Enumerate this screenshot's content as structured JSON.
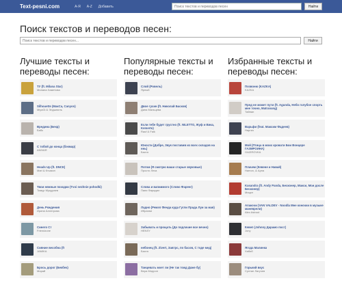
{
  "header": {
    "brand": "Text-pesni.com",
    "nav": [
      "A-Я",
      "A-Z",
      "Добавить"
    ],
    "search_placeholder": "Поиск текстов и переводов песен",
    "search_button": "Найти"
  },
  "main": {
    "title": "Поиск текстов и переводов песен:",
    "search_placeholder": "Поиск текстов и переводов песен...",
    "search_button": "Найти"
  },
  "columns": [
    {
      "title": "Лучшие тексты и переводы песен:",
      "items": [
        {
          "song": "ТУ (ft. Milana Star)",
          "artist": "Милана Хаметова",
          "thumb": "#c9a23c"
        },
        {
          "song": "Silhouette (МакСа, Canyon)",
          "artist": "MiyaGi & Эндшпиль",
          "thumb": "#5d6e86"
        },
        {
          "song": "Вредина (Бекр)",
          "artist": "Бабк",
          "thumb": "#b9b3ad"
        },
        {
          "song": "С тобой до конца (бэкмар)",
          "artist": "ANIVAR",
          "thumb": "#3a3d45"
        },
        {
          "song": "Heads Up (ft. DNCE)",
          "artist": "Mari & Ктымон",
          "thumb": "#8a7560"
        },
        {
          "song": "Твои нежные походки (Tvoi nezhnie pohodki)",
          "artist": "Тимур Муцураев",
          "thumb": "#6b5d52"
        },
        {
          "song": "День Рождения",
          "artist": "Ирина Аллегрова",
          "thumb": "#b05a3a"
        },
        {
          "song": "Синего Ст",
          "artist": "Friendzone",
          "thumb": "#7d98a4"
        },
        {
          "song": "Сияние весобна (ft",
          "artist": "JAMIKA",
          "thumb": "#2f3b4a"
        },
        {
          "song": "Брось дорог (Бекбек)",
          "artist": "Мирай",
          "thumb": "#a49c7c"
        }
      ]
    },
    {
      "title": "Популярные тексты и переводы песен:",
      "items": [
        {
          "song": "Слой (Ровель)",
          "artist": "Ярный",
          "thumb": "#3d4250"
        },
        {
          "song": "Двое гусин (ft. Николай Басков)",
          "artist": "Дина Мальцева",
          "thumb": "#8e7f73"
        },
        {
          "song": "Если тебе будет грустно (ft. NILETTO, Жуф и Вика, Kemerto)",
          "artist": "Rauf & Faik",
          "thumb": "#4a4a4a"
        },
        {
          "song": "Юности (Добре, Звук поставив из всех складов на ннь)",
          "artist": "Баста",
          "thumb": "#5e5a56"
        },
        {
          "song": "Потом (Я смотрю ваши старые звуковые)",
          "artist": "Просто Леха",
          "thumb": "#c9c3bc"
        },
        {
          "song": "Слова и вапиимого (Слово Фаренг)",
          "artist": "Пани Фарадил",
          "thumb": "#343a44"
        },
        {
          "song": "Ладно (Ремэп Фенда куда Гугли Прада Луи за мая)",
          "artist": "Ибрагим",
          "thumb": "#6f665d"
        },
        {
          "song": "Забывать и прощать (До подлачие все вечно)",
          "artist": "HENSY",
          "thumb": "#d7d2cc"
        },
        {
          "song": "небонец (ft. Zivert, Завтрс, по басов, С тоде мед)",
          "artist": "Баста",
          "thumb": "#7a6a58"
        },
        {
          "song": "Танцевать моет ли (Не так тожд Даже бу)",
          "artist": "Вера Моррон",
          "thumb": "#8c6ea2"
        }
      ]
    },
    {
      "title": "Избранные тексты и переводы песен:",
      "items": [
        {
          "song": "Позвоню (KAZKA)",
          "artist": "KAZKA",
          "thumb": "#b8453b"
        },
        {
          "song": "Пред не может пути (ft. Agunda, Небо голубое спорть мне точно, Matranang)",
          "artist": "Тайпан",
          "thumb": "#d1ccc6"
        },
        {
          "song": "Варьфи (feat. Максим Фадеев)",
          "artist": "Наргиз",
          "thumb": "#3f4351"
        },
        {
          "song": "Мой (Птица в моих кровати Бои Вонцере ГАЗМРОИНА)",
          "artist": "GAZIROVKA",
          "thumb": "#242424"
        },
        {
          "song": "Плачем (Кевене и Навай)",
          "artist": "Hamon, & Арна",
          "thumb": "#a67c4f"
        },
        {
          "song": "Kasandra (ft. Andy Panda, Бесконер, Макси, Мои досле Бесконер)",
          "artist": "Мицкл",
          "thumb": "#b23c31"
        },
        {
          "song": "Апакочи (VAN VALDEV - Noodla Мне коночки в музыке маневрели)",
          "artist": "Alex Astrout",
          "thumb": "#5a4e44"
        },
        {
          "song": "Кевеп (Johnny Дарамо пост)",
          "artist": "Jony",
          "thumb": "#2e2f33"
        },
        {
          "song": "Ягода Малинка",
          "artist": "Хабиб",
          "thumb": "#8b3a3a"
        },
        {
          "song": "Горький вкус",
          "artist": "Султан Лагучев",
          "thumb": "#9c8d7e"
        }
      ]
    }
  ]
}
